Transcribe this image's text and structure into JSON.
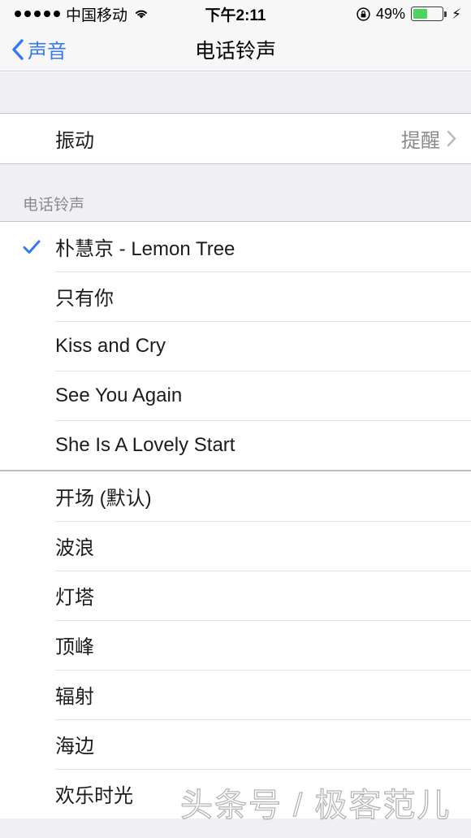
{
  "status_bar": {
    "signal_dots": 5,
    "carrier": "中国移动",
    "wifi_icon": "wifi-icon",
    "time": "下午2:11",
    "rotation_lock_icon": "rotation-lock-icon",
    "battery_percent": "49%",
    "battery_level": 49,
    "battery_color": "#4cd45f",
    "charging_icon": "⚡"
  },
  "nav": {
    "back_label": "声音",
    "back_icon": "chevron-left-icon",
    "title": "电话铃声",
    "accent_color": "#3478f6"
  },
  "vibration": {
    "label": "振动",
    "value": "提醒",
    "chevron_icon": "chevron-right-icon"
  },
  "ringtones_section": {
    "header": "电话铃声",
    "custom": [
      {
        "label": "朴慧京 - Lemon Tree",
        "selected": true
      },
      {
        "label": "只有你",
        "selected": false
      },
      {
        "label": "Kiss and Cry",
        "selected": false
      },
      {
        "label": "See You Again",
        "selected": false
      },
      {
        "label": "She Is A Lovely Start",
        "selected": false
      }
    ],
    "builtin": [
      {
        "label": "开场 (默认)",
        "selected": false
      },
      {
        "label": "波浪",
        "selected": false
      },
      {
        "label": "灯塔",
        "selected": false
      },
      {
        "label": "顶峰",
        "selected": false
      },
      {
        "label": "辐射",
        "selected": false
      },
      {
        "label": "海边",
        "selected": false
      },
      {
        "label": "欢乐时光",
        "selected": false
      }
    ],
    "check_icon": "checkmark-icon",
    "check_color": "#3478f6"
  },
  "watermark": {
    "text": "头条号 / 极客范儿"
  }
}
